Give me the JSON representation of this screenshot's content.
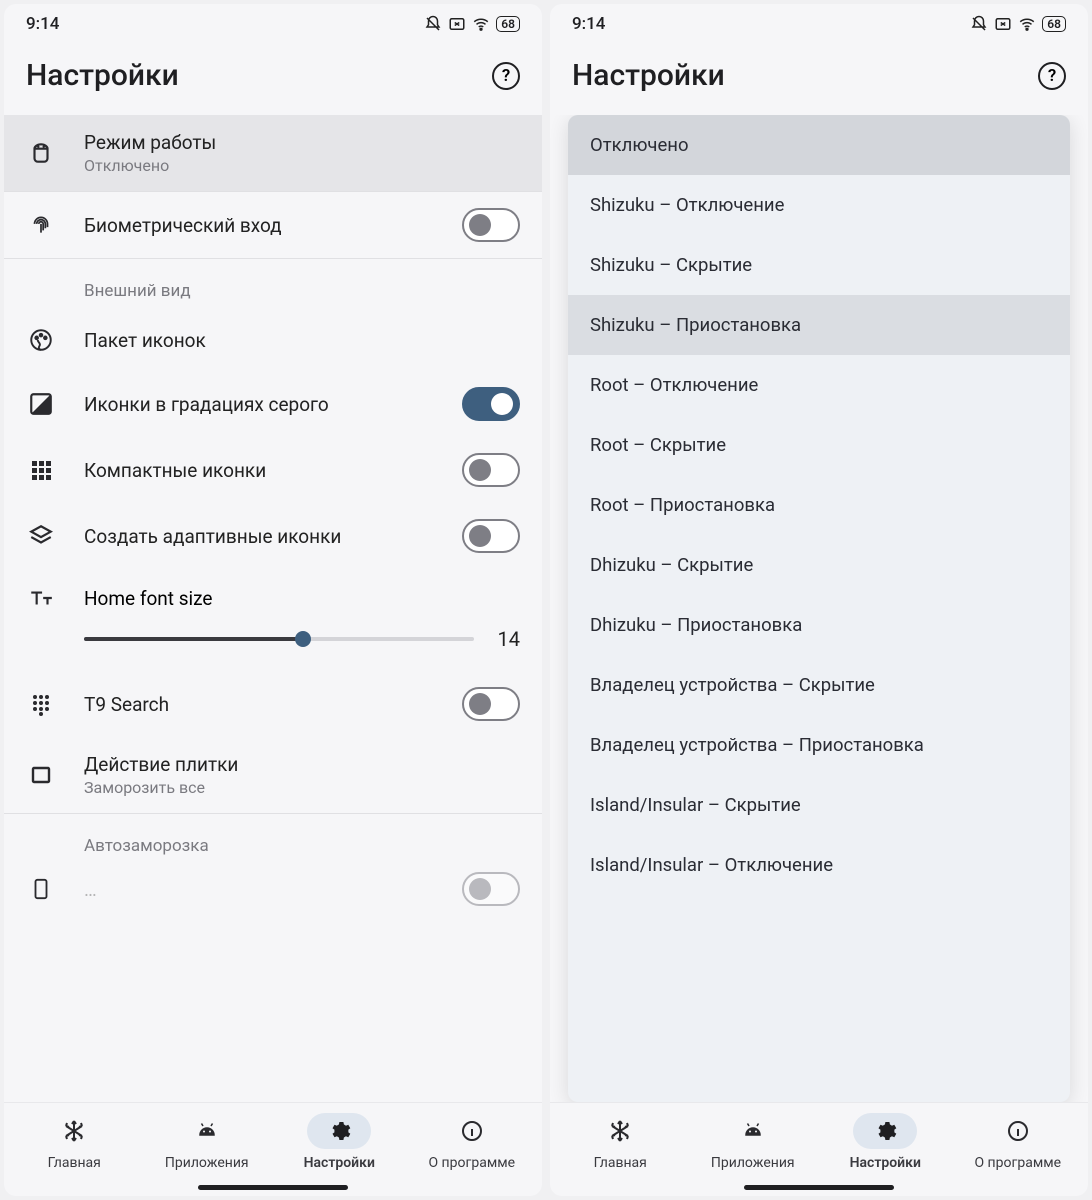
{
  "status": {
    "time": "9:14",
    "battery": "68"
  },
  "header": {
    "title": "Настройки"
  },
  "left": {
    "operation_mode": {
      "title": "Режим работы",
      "subtitle": "Отключено"
    },
    "biometric": {
      "title": "Биометрический вход",
      "on": false
    },
    "appearance_header": "Внешний вид",
    "icon_pack": {
      "title": "Пакет иконок"
    },
    "grayscale_icons": {
      "title": "Иконки в градациях серого",
      "on": true
    },
    "compact_icons": {
      "title": "Компактные иконки",
      "on": false
    },
    "adaptive_icons": {
      "title": "Создать адаптивные иконки",
      "on": false
    },
    "font_size": {
      "title": "Home font size",
      "value": "14",
      "percent": 55
    },
    "t9": {
      "title": "T9 Search",
      "on": false
    },
    "tile_action": {
      "title": "Действие плитки",
      "subtitle": "Заморозить все"
    },
    "autofreeze_header": "Автозаморозка"
  },
  "dropdown": {
    "items": [
      {
        "label": "Отключено",
        "state": "selected"
      },
      {
        "label": "Shizuku – Отключение",
        "state": ""
      },
      {
        "label": "Shizuku – Скрытие",
        "state": ""
      },
      {
        "label": "Shizuku – Приостановка",
        "state": "hover"
      },
      {
        "label": "Root – Отключение",
        "state": ""
      },
      {
        "label": "Root – Скрытие",
        "state": ""
      },
      {
        "label": "Root – Приостановка",
        "state": ""
      },
      {
        "label": "Dhizuku – Скрытие",
        "state": ""
      },
      {
        "label": "Dhizuku – Приостановка",
        "state": ""
      },
      {
        "label": "Владелец устройства – Скрытие",
        "state": ""
      },
      {
        "label": "Владелец устройства – Приостановка",
        "state": ""
      },
      {
        "label": "Island/Insular – Скрытие",
        "state": ""
      },
      {
        "label": "Island/Insular – Отключение",
        "state": ""
      }
    ]
  },
  "nav": {
    "items": [
      {
        "label": "Главная",
        "icon": "snowflake",
        "active": false
      },
      {
        "label": "Приложения",
        "icon": "android",
        "active": false
      },
      {
        "label": "Настройки",
        "icon": "gear",
        "active": true
      },
      {
        "label": "О программе",
        "icon": "info",
        "active": false
      }
    ]
  }
}
